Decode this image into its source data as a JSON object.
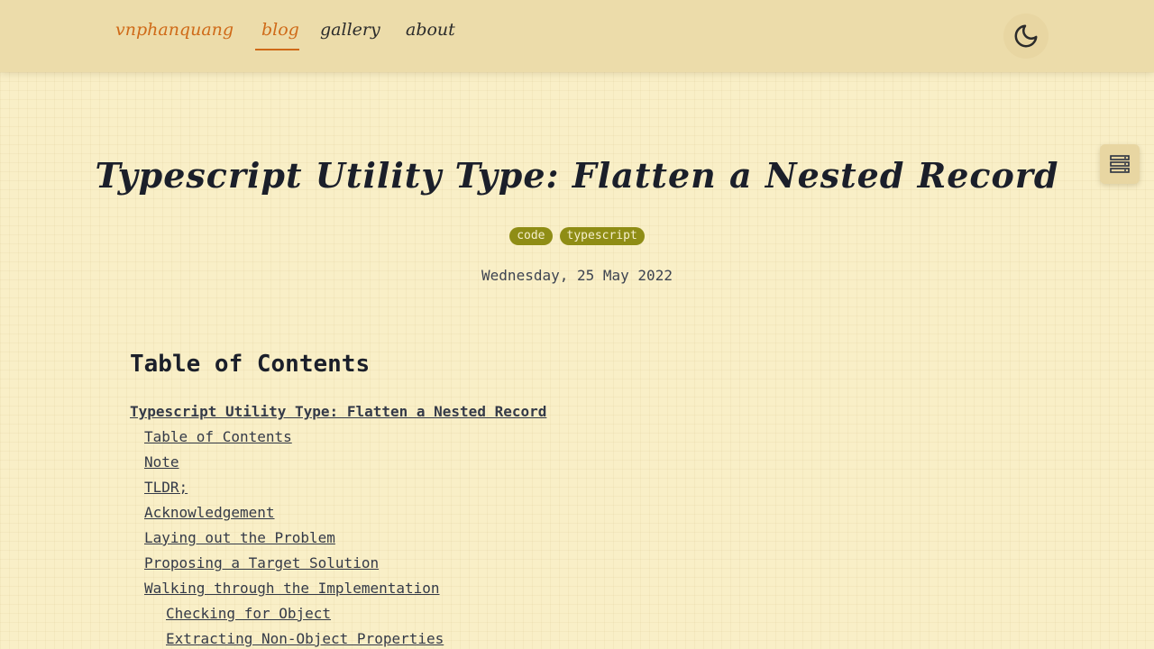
{
  "nav": {
    "logo": "vnphanquang",
    "links": [
      {
        "label": "blog",
        "active": true
      },
      {
        "label": "gallery",
        "active": false
      },
      {
        "label": "about",
        "active": false
      }
    ]
  },
  "theme_toggle_icon": "moon-icon",
  "toc_toggle_icon": "table-of-contents-icon",
  "post": {
    "title": "Typescript Utility Type: Flatten a Nested Record",
    "tags": [
      "code",
      "typescript"
    ],
    "date": "Wednesday, 25 May 2022"
  },
  "toc": {
    "heading": "Table of Contents",
    "items": [
      {
        "label": "Typescript Utility Type: Flatten a Nested Record",
        "level": 0
      },
      {
        "label": "Table of Contents",
        "level": 1
      },
      {
        "label": "Note",
        "level": 1
      },
      {
        "label": "TLDR;",
        "level": 1
      },
      {
        "label": "Acknowledgement",
        "level": 1
      },
      {
        "label": "Laying out the Problem",
        "level": 1
      },
      {
        "label": "Proposing a Target Solution",
        "level": 1
      },
      {
        "label": "Walking through the Implementation",
        "level": 1
      },
      {
        "label": "Checking for Object",
        "level": 2
      },
      {
        "label": "Extracting Non-Object Properties",
        "level": 2
      }
    ]
  },
  "colors": {
    "accent": "#cf6a18",
    "tag": "#8f8d15",
    "background": "#f9efc7",
    "header": "#ecdcaa"
  }
}
